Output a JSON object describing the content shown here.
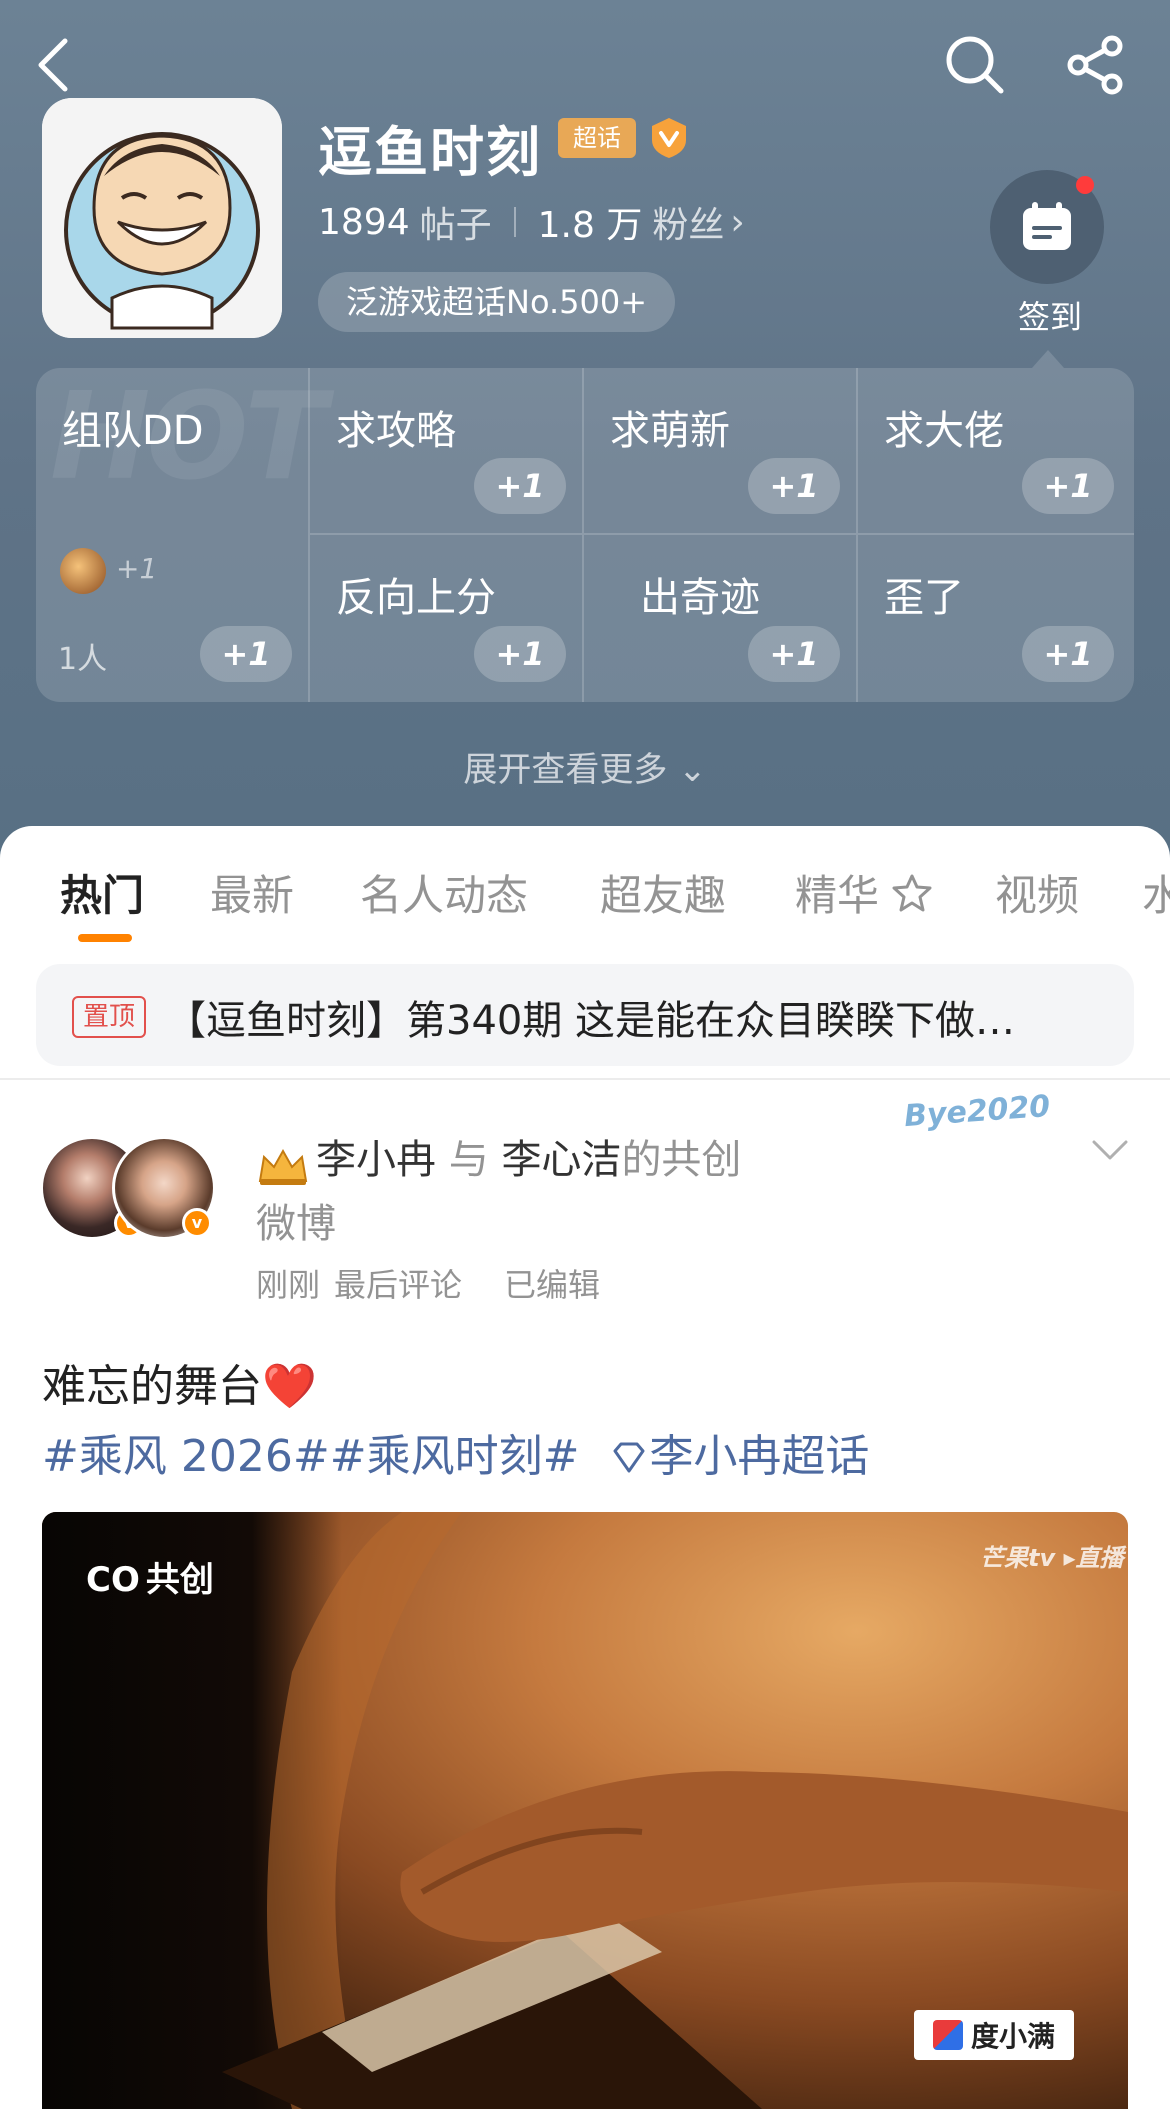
{
  "header": {
    "title": "逗鱼时刻",
    "super_badge": "超话",
    "posts_count": "1894",
    "posts_label": "帖子",
    "fans_count": "1.8 万",
    "fans_label": "粉丝",
    "fans_arrow": "›",
    "rank_text": "泛游戏超话No.500+",
    "checkin_label": "签到",
    "expand_more": "展开查看更多 ⌄"
  },
  "tag_grid": {
    "watermark": "HOT",
    "team": {
      "name": "组队DD",
      "avatar_plus": "+1",
      "count": "1人",
      "plus": "+1"
    },
    "tags": [
      {
        "name": "求攻略",
        "plus": "+1"
      },
      {
        "name": "求萌新",
        "plus": "+1"
      },
      {
        "name": "求大佬",
        "plus": "+1"
      },
      {
        "name": "反向上分",
        "plus": "+1"
      },
      {
        "name": "出奇迹",
        "plus": "+1"
      },
      {
        "name": "歪了",
        "plus": "+1"
      }
    ]
  },
  "tabs": [
    {
      "label": "热门",
      "active": true
    },
    {
      "label": "最新"
    },
    {
      "label": "名人动态"
    },
    {
      "label": "超友趣"
    },
    {
      "label": "精华"
    },
    {
      "label": "视频"
    },
    {
      "label": "水"
    }
  ],
  "pinned": {
    "badge": "置顶",
    "text": "【逗鱼时刻】第340期 这是能在众目睽睽下做…"
  },
  "post": {
    "author1": "李小冉",
    "conj": "与",
    "author2": "李心洁",
    "title_suffix": "的共创微博",
    "meta_time": "刚刚",
    "meta_last_comment": "最后评论",
    "meta_edited": "已编辑",
    "signature": "Bye2020",
    "body": "难忘的舞台❤️",
    "tags": "#乘风 2026##乘风时刻#",
    "supertopic": "李小冉超话",
    "video": {
      "cocreate": "共创",
      "watermark": "芒果tv ▸直播",
      "sponsor": "度小满"
    }
  },
  "colors": {
    "header_bg": "#5f7387",
    "accent": "#ff8200",
    "tag_blue": "#4d6aa0",
    "super_badge": "#e8a856",
    "pin_red": "#e2504c"
  }
}
